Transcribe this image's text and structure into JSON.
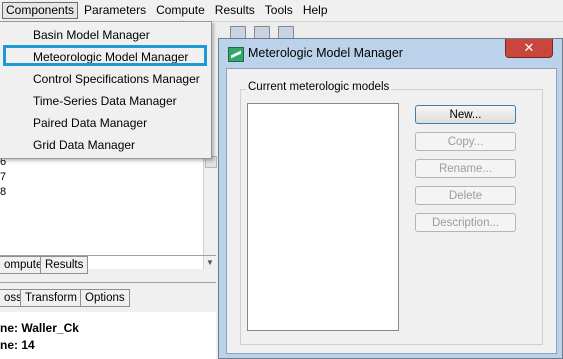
{
  "menubar": {
    "items": [
      "Components",
      "Parameters",
      "Compute",
      "Results",
      "Tools",
      "Help"
    ]
  },
  "components_menu": {
    "items": [
      "Basin Model Manager",
      "Meteorologic Model Manager",
      "Control Specifications Manager",
      "Time-Series Data Manager",
      "Paired Data Manager",
      "Grid Data Manager"
    ],
    "highlighted": "Meteorologic Model Manager"
  },
  "left_panel": {
    "tree_numbers": [
      "6",
      "7",
      "8"
    ],
    "tabs_row1": [
      "ompute",
      "Results"
    ],
    "tabs_row2": [
      "oss",
      "Transform",
      "Options"
    ],
    "info": {
      "line1": "ne: Waller_Ck",
      "line2": "ne: 14"
    }
  },
  "dialog": {
    "title": "Meterologic Model Manager",
    "close_label": "x",
    "group_label": "Current meterologic models",
    "models": [],
    "buttons": {
      "new": "New...",
      "copy": "Copy...",
      "rename": "Rename...",
      "delete": "Delete",
      "description": "Description..."
    }
  },
  "colors": {
    "menu_highlight_border": "#1e9bd7",
    "dialog_frame": "#bcd2ea",
    "close_button": "#c9463d"
  }
}
